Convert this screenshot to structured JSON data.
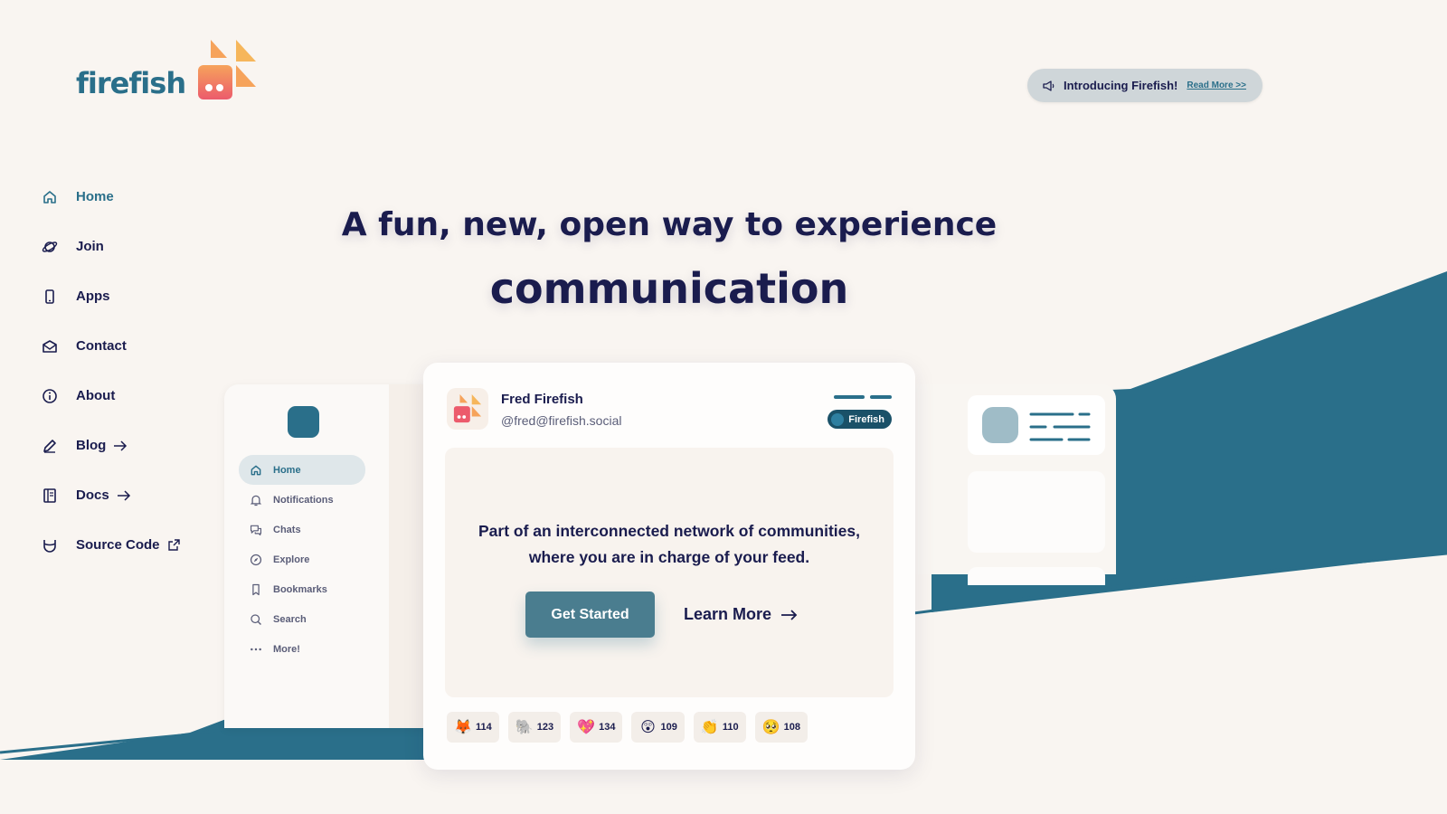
{
  "brand": {
    "name": "firefish",
    "color": "#2a6f8a",
    "accent_orange": "#f6a35b",
    "accent_pink": "#ec5b6c"
  },
  "announcement": {
    "text": "Introducing Firefish!",
    "link": "Read More >>"
  },
  "sidebar": {
    "items": [
      {
        "label": "Home",
        "icon": "home-icon"
      },
      {
        "label": "Join",
        "icon": "planet-icon"
      },
      {
        "label": "Apps",
        "icon": "phone-icon"
      },
      {
        "label": "Contact",
        "icon": "mail-icon"
      },
      {
        "label": "About",
        "icon": "info-icon"
      },
      {
        "label": "Blog",
        "icon": "pencil-icon",
        "trailing": "arrow-right-icon"
      },
      {
        "label": "Docs",
        "icon": "book-icon",
        "trailing": "arrow-right-icon"
      },
      {
        "label": "Source Code",
        "icon": "code-icon",
        "trailing": "external-link-icon"
      }
    ]
  },
  "hero": {
    "line1": "A fun, new, open way to experience",
    "line2": "communication"
  },
  "mock_nav": {
    "items": [
      {
        "label": "Home",
        "icon": "home-icon"
      },
      {
        "label": "Notifications",
        "icon": "bell-icon"
      },
      {
        "label": "Chats",
        "icon": "chat-icon"
      },
      {
        "label": "Explore",
        "icon": "compass-icon"
      },
      {
        "label": "Bookmarks",
        "icon": "bookmark-icon"
      },
      {
        "label": "Search",
        "icon": "search-icon"
      },
      {
        "label": "More!",
        "icon": "dots-icon"
      }
    ]
  },
  "post": {
    "name": "Fred Firefish",
    "handle": "@fred@firefish.social",
    "badge": "Firefish",
    "text_line1": "Part of an interconnected network of communities,",
    "text_line2": "where you are in charge of your feed.",
    "primary_button": "Get Started",
    "secondary_button": "Learn More",
    "reactions": [
      {
        "emoji": "🦊",
        "count": "114"
      },
      {
        "emoji": "🐘",
        "count": "123"
      },
      {
        "emoji": "💖",
        "count": "134"
      },
      {
        "emoji": "😲",
        "count": "109"
      },
      {
        "emoji": "👏",
        "count": "110"
      },
      {
        "emoji": "🥺",
        "count": "108"
      }
    ]
  }
}
